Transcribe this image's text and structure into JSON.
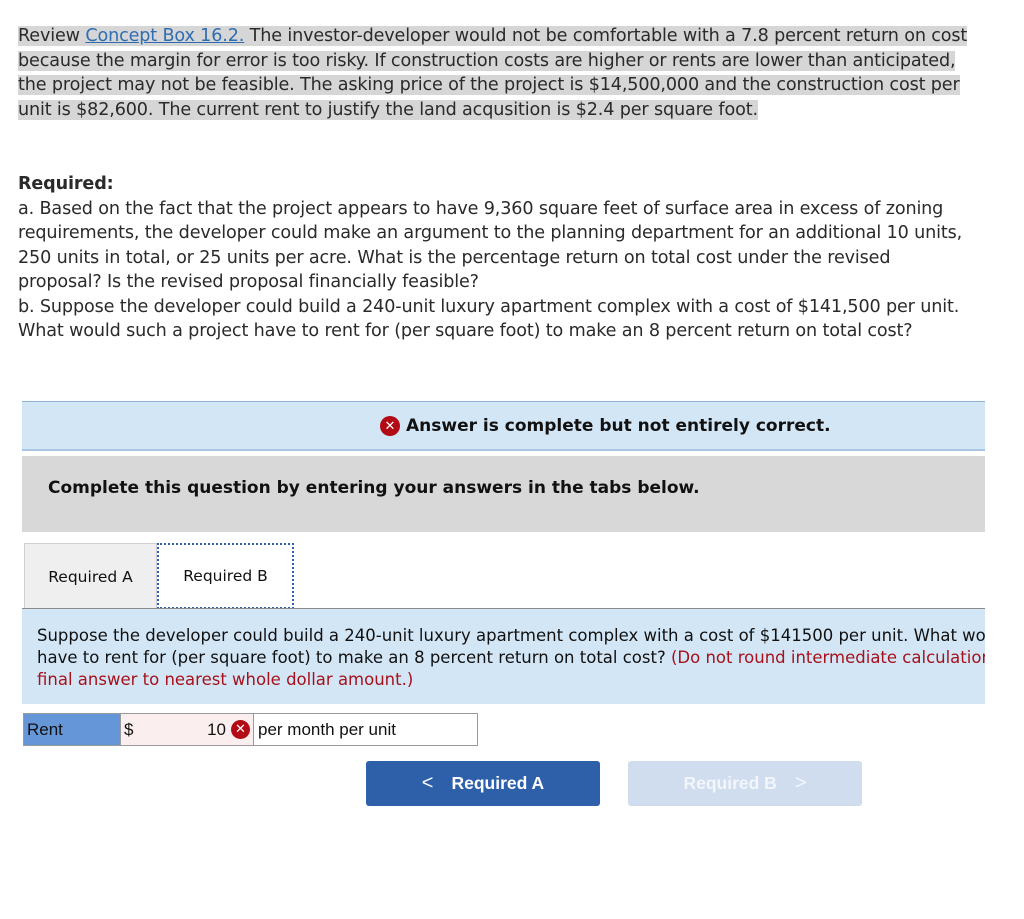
{
  "problem": {
    "prefix": "Review ",
    "link": "Concept Box 16.2.",
    "body": " The investor-developer would not be comfortable with a 7.8 percent return on cost because the margin for error is too risky. If construction costs are higher or rents are lower than anticipated, the project may not be feasible. The asking price of the project is $14,500,000 and the construction cost per unit is $82,600. The current rent to justify the land acqusition is $2.4 per square foot."
  },
  "required": {
    "title": "Required:",
    "part_a": "a. Based on the fact that the project appears to have 9,360 square feet of surface area in excess of zoning requirements, the developer could make an argument to the planning department for an additional 10 units, 250 units in total, or 25 units per acre. What is the percentage return on total cost under the revised proposal? Is the revised proposal financially feasible?",
    "part_b": "b. Suppose the developer could build a 240-unit luxury apartment complex with a cost of $141,500 per unit. What would such a project have to rent for (per square foot) to make an 8 percent return on total cost?"
  },
  "status": {
    "icon": "x-circle-icon",
    "message": "Answer is complete but not entirely correct."
  },
  "instructions": "Complete this question by entering your answers in the tabs below.",
  "tabs": [
    {
      "label": "Required A",
      "active": false
    },
    {
      "label": "Required B",
      "active": true
    }
  ],
  "question": {
    "text": "Suppose the developer could build a 240-unit luxury apartment complex with a cost of $141500 per unit. What would such a project have to rent for (per square foot) to make an 8 percent return on total cost?",
    "note": "(Do not round intermediate calculations. Round your final answer to nearest whole dollar amount.)"
  },
  "answer_row": {
    "label": "Rent",
    "currency": "$",
    "value": "10",
    "status": "incorrect",
    "unit": "per month per unit"
  },
  "nav": {
    "prev_label": "Required A",
    "next_label": "Required B",
    "prev_glyph": "<",
    "next_glyph": ">"
  },
  "colors": {
    "link": "#2f6db3",
    "banner_bg": "#d3e6f6",
    "error_red": "#b20b16",
    "note_red": "#a6111b",
    "primary_button": "#2e60aa",
    "disabled_button": "#d0ddef",
    "label_cell": "#6496d8"
  }
}
